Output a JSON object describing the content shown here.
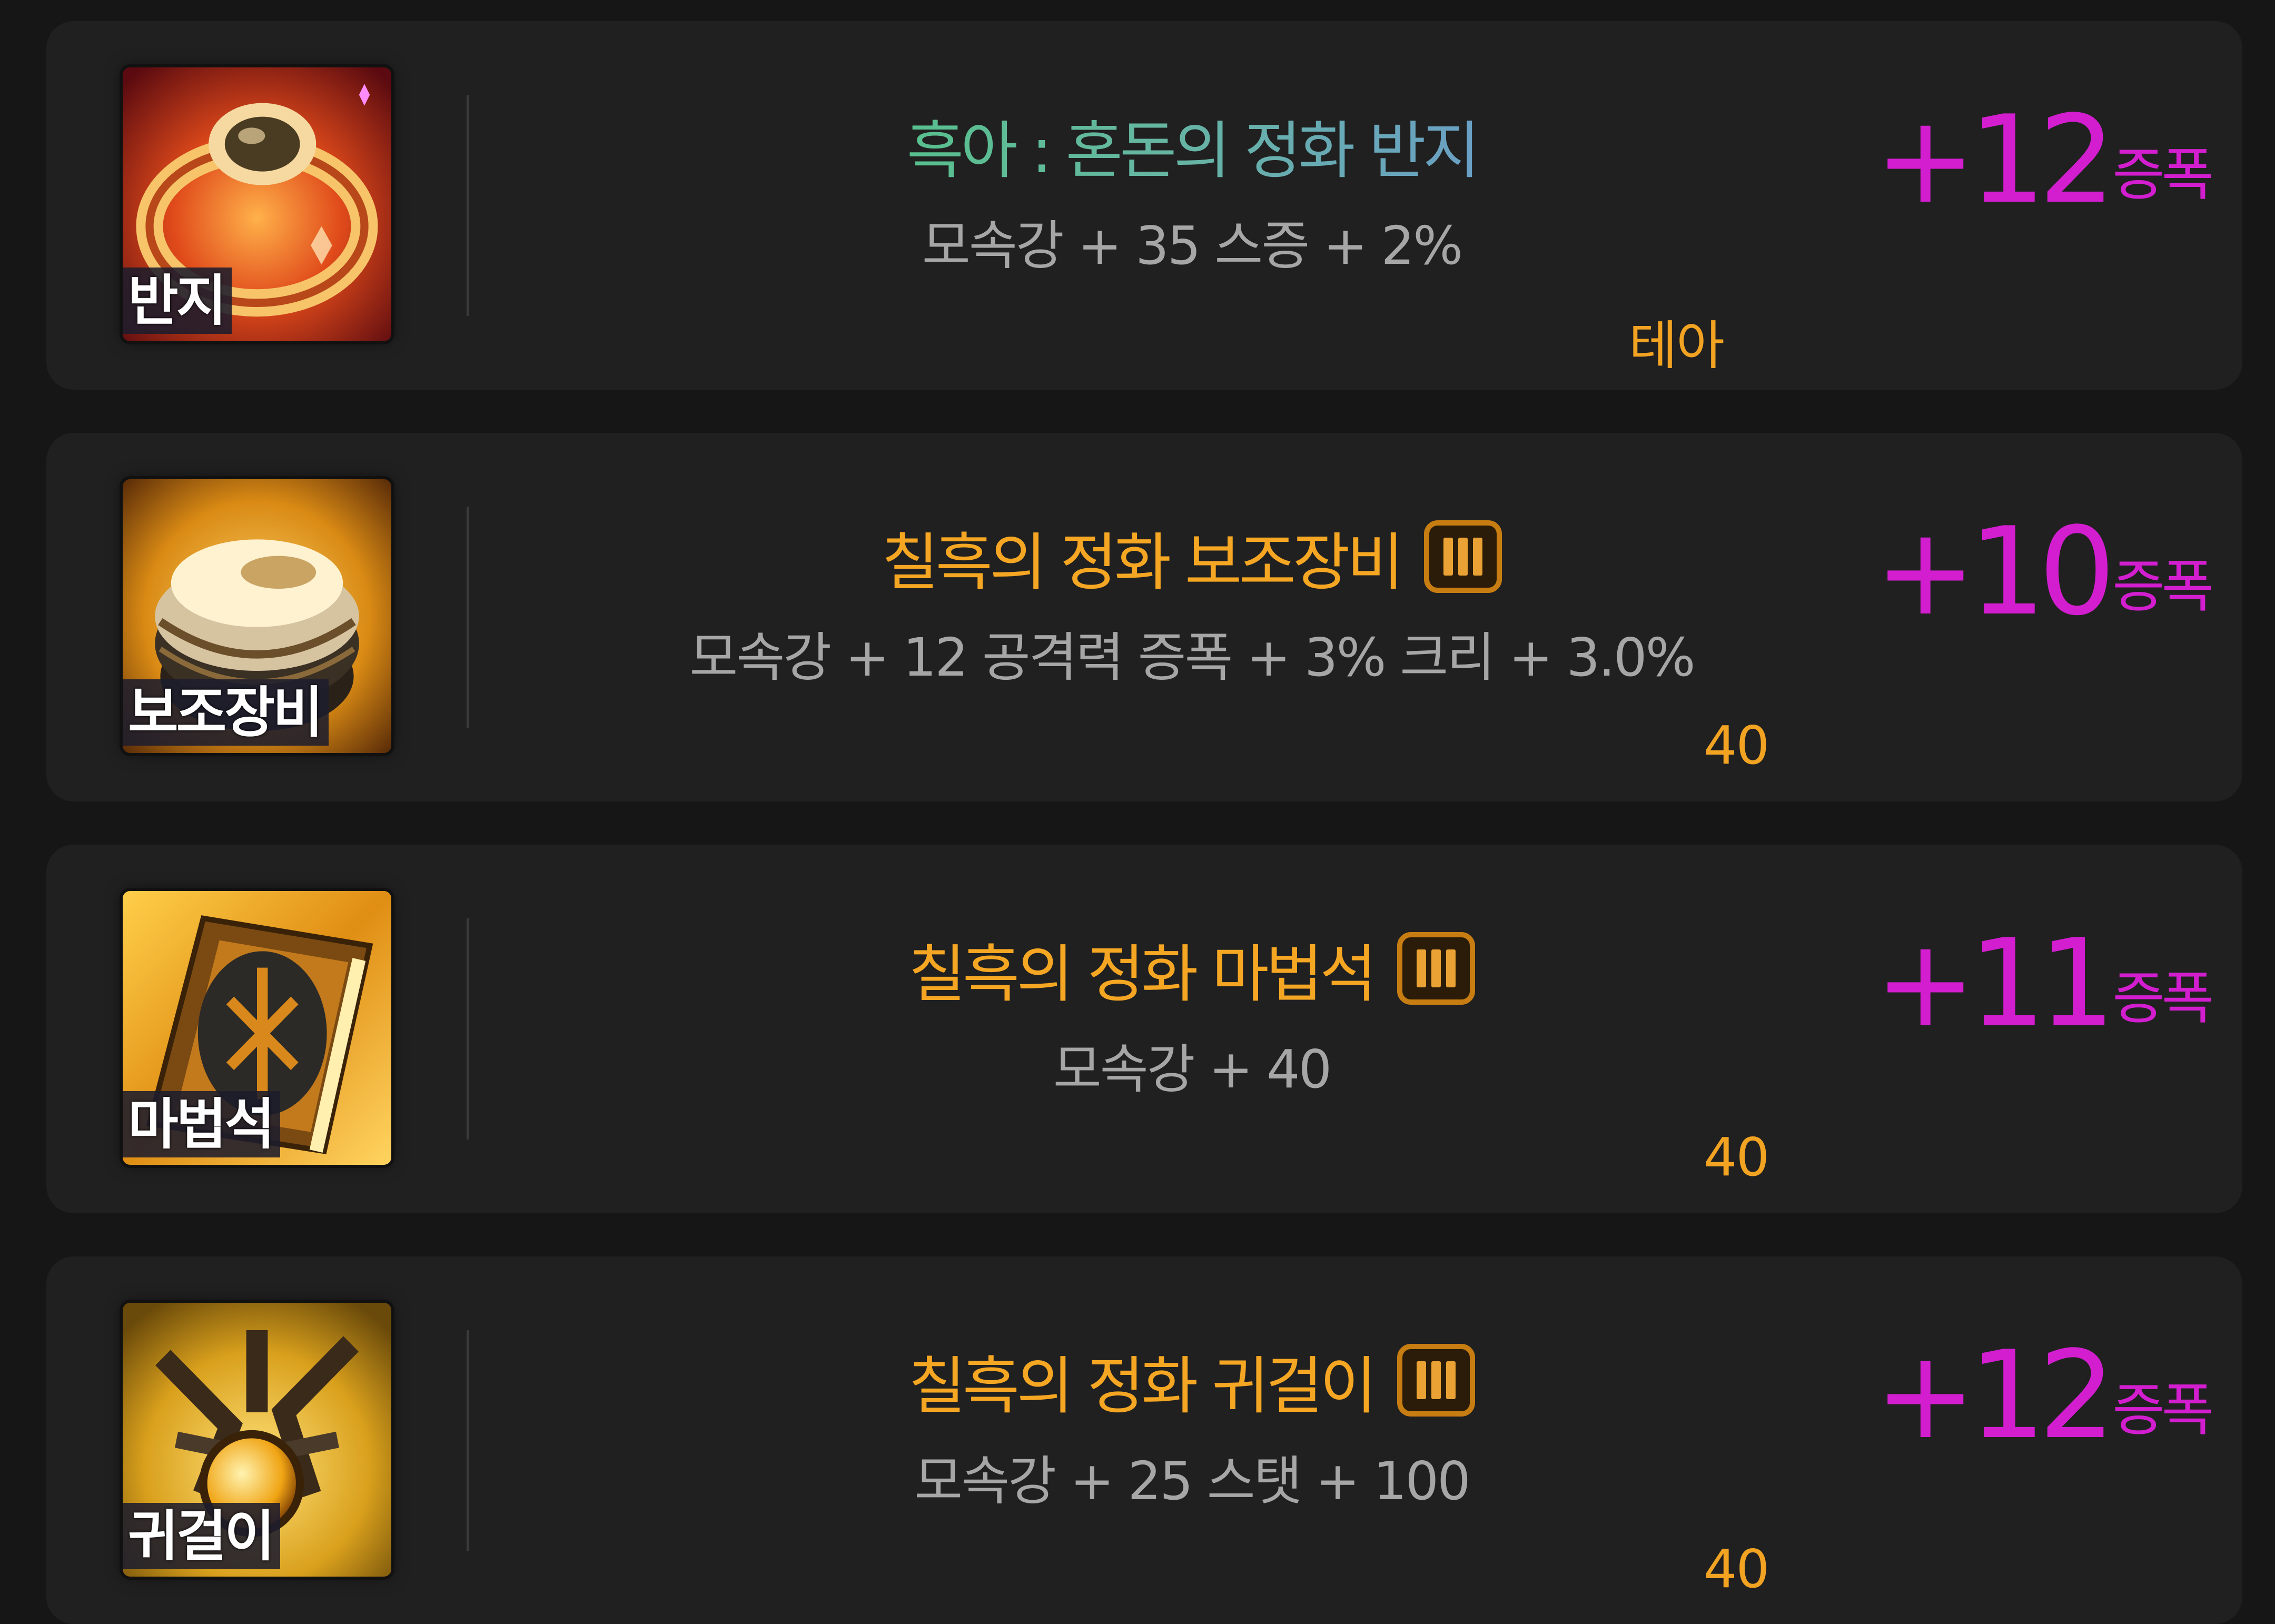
{
  "items": [
    {
      "slot": "반지",
      "title": "흑아 : 혼돈의 정화 반지",
      "title_style": "gradient",
      "tier": "",
      "stats": "모속강 + 35 스증 + 2%",
      "source": "테아",
      "enhance": "+12",
      "enhance_unit": "증폭",
      "icon": "ring-icon"
    },
    {
      "slot": "보조장비",
      "title": "칠흑의 정화 보조장비",
      "title_style": "orange",
      "tier": "III",
      "stats": "모속강 + 12 공격력 증폭 + 3% 크리 + 3.0%",
      "source": "40",
      "enhance": "+10",
      "enhance_unit": "증폭",
      "icon": "sub-equipment-icon"
    },
    {
      "slot": "마법석",
      "title": "칠흑의 정화 마법석",
      "title_style": "orange",
      "tier": "III",
      "stats": "모속강 + 40",
      "source": "40",
      "enhance": "+11",
      "enhance_unit": "증폭",
      "icon": "magic-stone-icon"
    },
    {
      "slot": "귀걸이",
      "title": "칠흑의 정화 귀걸이",
      "title_style": "orange",
      "tier": "III",
      "stats": "모속강 + 25 스탯 + 100",
      "source": "40",
      "enhance": "+12",
      "enhance_unit": "증폭",
      "icon": "earring-icon"
    }
  ],
  "colors": {
    "background": "#161616",
    "card": "#202020",
    "title_orange": "#f5a623",
    "stats_gray": "#a6a6a6",
    "source_orange": "#f2a322",
    "enhance_magenta": "#d31ed0"
  }
}
